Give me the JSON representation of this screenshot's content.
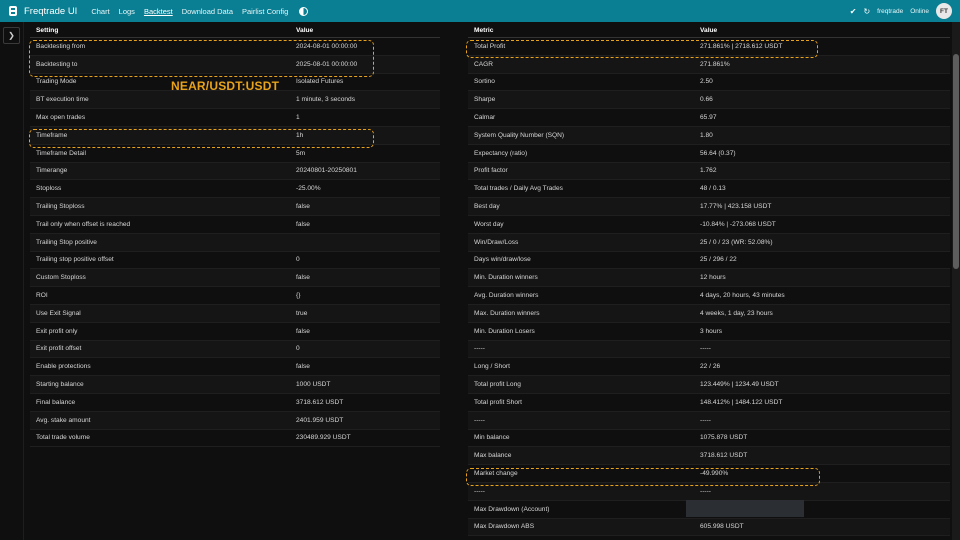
{
  "nav": {
    "brand": "Freqtrade UI",
    "links": [
      "Chart",
      "Logs",
      "Backtest",
      "Download Data",
      "Pairlist Config"
    ],
    "active_index": 2,
    "bot_name": "freqtrade",
    "status": "Online",
    "avatar": "FT"
  },
  "sidebar": {
    "toggle_icon": "chevron-right-icon"
  },
  "overlay": {
    "pair_label": "NEAR/USDT:USDT",
    "accent_color": "#e8a31b"
  },
  "left_table": {
    "headers": [
      "Setting",
      "Value"
    ],
    "rows": [
      [
        "Backtesting from",
        "2024-08-01 00:00:00"
      ],
      [
        "Backtesting to",
        "2025-08-01 00:00:00"
      ],
      [
        "Trading Mode",
        "Isolated Futures"
      ],
      [
        "BT execution time",
        "1 minute, 3 seconds"
      ],
      [
        "Max open trades",
        "1"
      ],
      [
        "Timeframe",
        "1h"
      ],
      [
        "Timeframe Detail",
        "5m"
      ],
      [
        "Timerange",
        "20240801-20250801"
      ],
      [
        "Stoploss",
        "-25.00%"
      ],
      [
        "Trailing Stoploss",
        "false"
      ],
      [
        "Trail only when offset is reached",
        "false"
      ],
      [
        "Trailing Stop positive",
        ""
      ],
      [
        "Trailing stop positive offset",
        "0"
      ],
      [
        "Custom Stoploss",
        "false"
      ],
      [
        "ROI",
        "{}"
      ],
      [
        "Use Exit Signal",
        "true"
      ],
      [
        "Exit profit only",
        "false"
      ],
      [
        "Exit profit offset",
        "0"
      ],
      [
        "Enable protections",
        "false"
      ],
      [
        "Starting balance",
        "1000 USDT"
      ],
      [
        "Final balance",
        "3718.612 USDT"
      ],
      [
        "Avg. stake amount",
        "2401.959 USDT"
      ],
      [
        "Total trade volume",
        "230489.929 USDT"
      ]
    ]
  },
  "right_table": {
    "headers": [
      "Metric",
      "Value"
    ],
    "rows": [
      [
        "Total Profit",
        "271.861% | 2718.612 USDT"
      ],
      [
        "CAGR",
        "271.861%"
      ],
      [
        "Sortino",
        "2.50"
      ],
      [
        "Sharpe",
        "0.66"
      ],
      [
        "Calmar",
        "65.97"
      ],
      [
        "System Quality Number (SQN)",
        "1.80"
      ],
      [
        "Expectancy (ratio)",
        "56.64 (0.37)"
      ],
      [
        "Profit factor",
        "1.762"
      ],
      [
        "Total trades / Daily Avg Trades",
        "48 / 0.13"
      ],
      [
        "Best day",
        "17.77% | 423.158 USDT"
      ],
      [
        "Worst day",
        "-10.84% | -273.068 USDT"
      ],
      [
        "Win/Draw/Loss",
        "25 / 0 / 23 (WR: 52.08%)"
      ],
      [
        "Days win/draw/lose",
        "25 / 296 / 22"
      ],
      [
        "Min. Duration winners",
        "12 hours"
      ],
      [
        "Avg. Duration winners",
        "4 days, 20 hours, 43 minutes"
      ],
      [
        "Max. Duration winners",
        "4 weeks, 1 day, 23 hours"
      ],
      [
        "Min. Duration Losers",
        "3 hours"
      ],
      [
        "-----",
        "-----"
      ],
      [
        "Long / Short",
        "22 / 26"
      ],
      [
        "Total profit Long",
        "123.449% | 1234.49 USDT"
      ],
      [
        "Total profit Short",
        "148.412% | 1484.122 USDT"
      ],
      [
        "-----",
        "-----"
      ],
      [
        "Min balance",
        "1075.878 USDT"
      ],
      [
        "Max balance",
        "3718.612 USDT"
      ],
      [
        "Market change",
        "-49.990%"
      ],
      [
        "-----",
        "-----"
      ],
      [
        "Max Drawdown (Account)",
        ""
      ],
      [
        "Max Drawdown ABS",
        "605.998 USDT"
      ]
    ]
  }
}
